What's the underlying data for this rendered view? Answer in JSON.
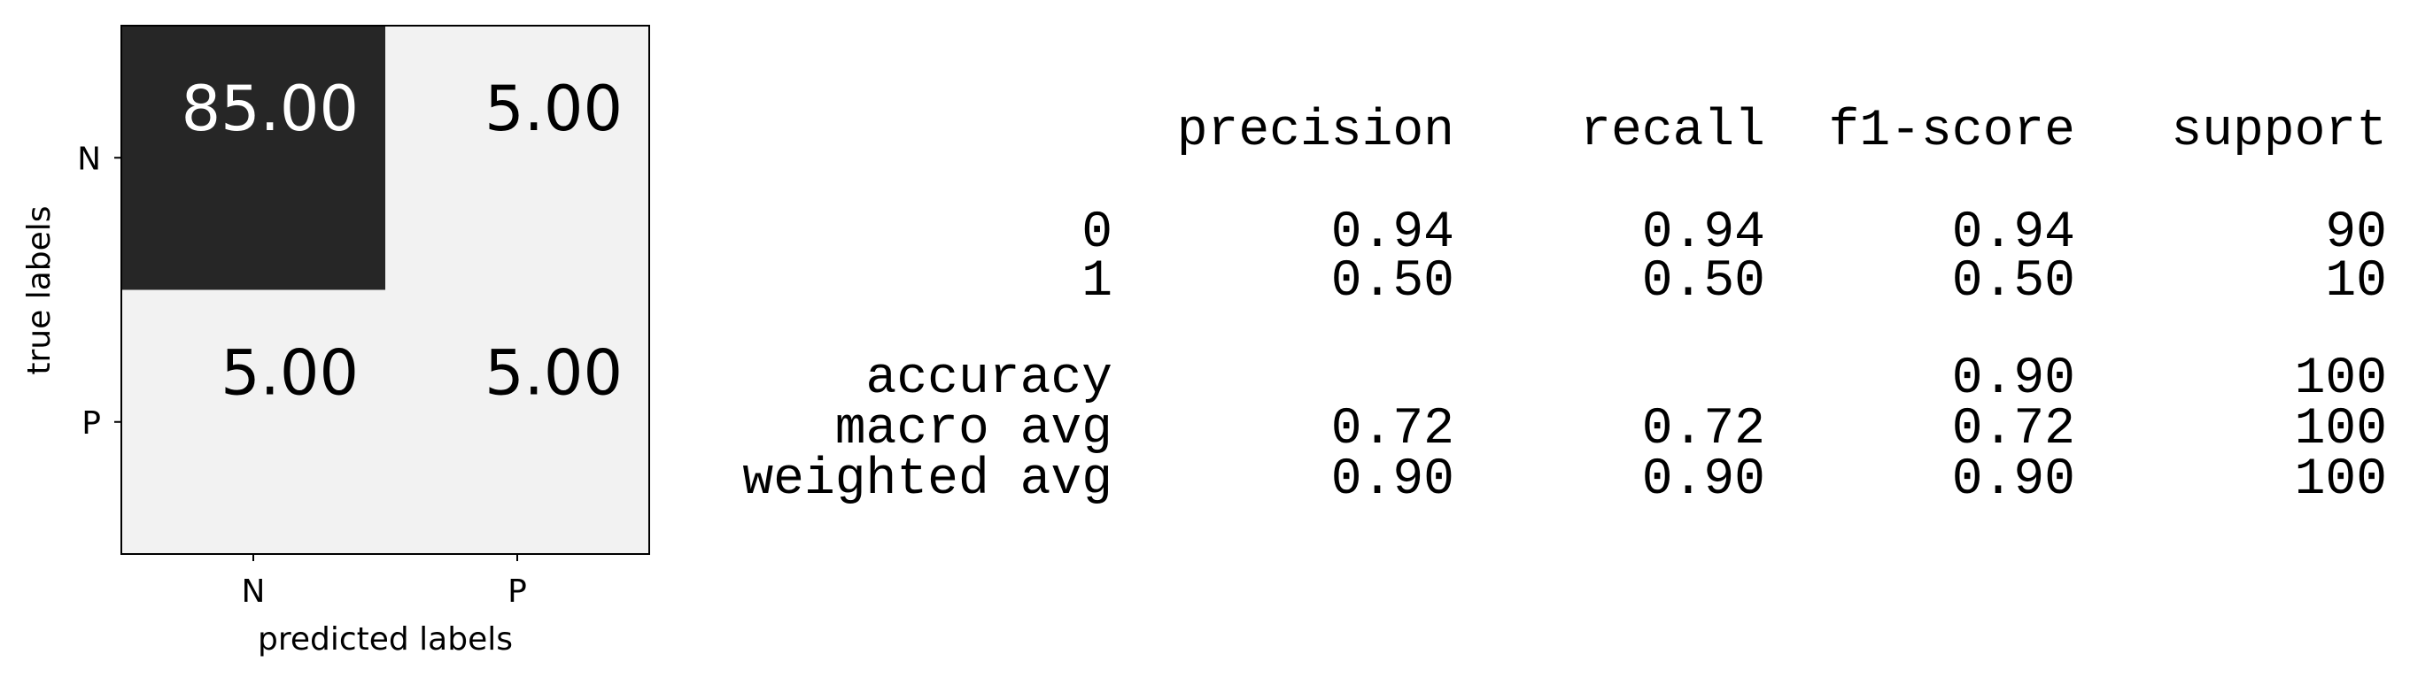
{
  "chart_data": [
    {
      "type": "heatmap",
      "title": "",
      "xlabel": "predicted labels",
      "ylabel": "true labels",
      "x_categories": [
        "N",
        "P"
      ],
      "y_categories": [
        "N",
        "P"
      ],
      "values": [
        [
          85.0,
          5.0
        ],
        [
          5.0,
          5.0
        ]
      ],
      "cell_labels": [
        [
          "85.00",
          "5.00"
        ],
        [
          "5.00",
          "5.00"
        ]
      ],
      "colormap": {
        "high": "#262626",
        "low": "#f2f2f2",
        "text_on_dark": "#ffffff",
        "text_on_light": "#000000"
      }
    },
    {
      "type": "table",
      "columns": [
        "precision",
        "recall",
        "f1-score",
        "support"
      ],
      "rows": [
        {
          "label": "0",
          "cells": [
            "0.94",
            "0.94",
            "0.94",
            "90"
          ]
        },
        {
          "label": "1",
          "cells": [
            "0.50",
            "0.50",
            "0.50",
            "10"
          ]
        },
        {
          "label": "accuracy",
          "cells": [
            "",
            "",
            "0.90",
            "100"
          ]
        },
        {
          "label": "macro avg",
          "cells": [
            "0.72",
            "0.72",
            "0.72",
            "100"
          ]
        },
        {
          "label": "weighted avg",
          "cells": [
            "0.90",
            "0.90",
            "0.90",
            "100"
          ]
        }
      ]
    }
  ]
}
